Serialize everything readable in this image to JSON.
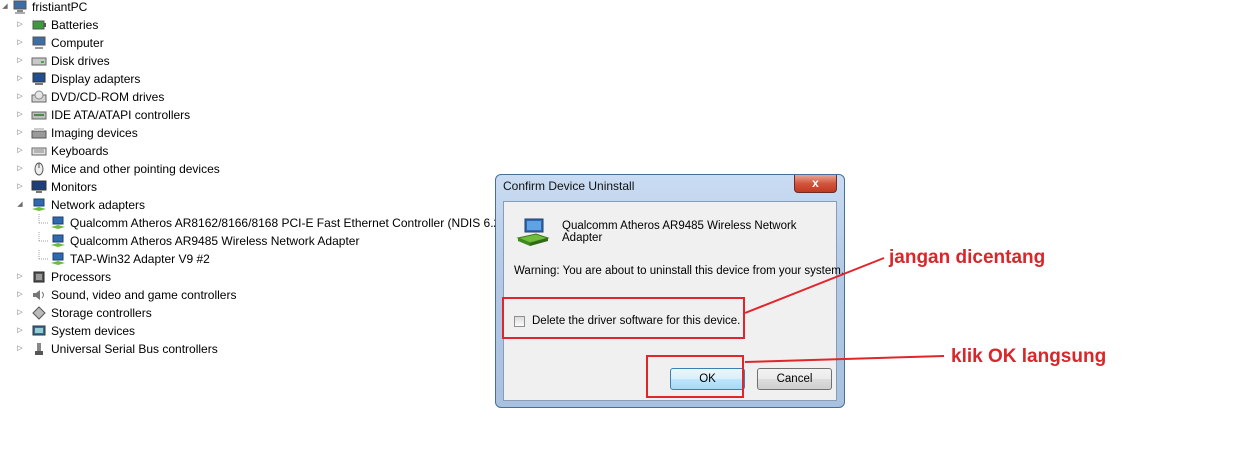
{
  "tree": {
    "root": "fristiantPC",
    "items": [
      {
        "label": "Batteries",
        "icon": "battery-icon",
        "expanded": false,
        "depth": 1
      },
      {
        "label": "Computer",
        "icon": "computer-icon",
        "expanded": false,
        "depth": 1
      },
      {
        "label": "Disk drives",
        "icon": "disk-drive-icon",
        "expanded": false,
        "depth": 1
      },
      {
        "label": "Display adapters",
        "icon": "display-adapter-icon",
        "expanded": false,
        "depth": 1
      },
      {
        "label": "DVD/CD-ROM drives",
        "icon": "dvd-drive-icon",
        "expanded": false,
        "depth": 1
      },
      {
        "label": "IDE ATA/ATAPI controllers",
        "icon": "ide-controller-icon",
        "expanded": false,
        "depth": 1
      },
      {
        "label": "Imaging devices",
        "icon": "imaging-device-icon",
        "expanded": false,
        "depth": 1
      },
      {
        "label": "Keyboards",
        "icon": "keyboard-icon",
        "expanded": false,
        "depth": 1
      },
      {
        "label": "Mice and other pointing devices",
        "icon": "mouse-icon",
        "expanded": false,
        "depth": 1
      },
      {
        "label": "Monitors",
        "icon": "monitor-icon",
        "expanded": false,
        "depth": 1
      },
      {
        "label": "Network adapters",
        "icon": "network-adapter-icon",
        "expanded": true,
        "depth": 1
      },
      {
        "label": "Qualcomm Atheros AR8162/8166/8168 PCI-E Fast Ethernet Controller (NDIS 6.20)",
        "icon": "network-adapter-icon",
        "depth": 2
      },
      {
        "label": "Qualcomm Atheros AR9485 Wireless Network Adapter",
        "icon": "network-adapter-icon",
        "depth": 2
      },
      {
        "label": "TAP-Win32 Adapter V9 #2",
        "icon": "network-adapter-icon",
        "depth": 2
      },
      {
        "label": "Processors",
        "icon": "processor-icon",
        "expanded": false,
        "depth": 1
      },
      {
        "label": "Sound, video and game controllers",
        "icon": "sound-icon",
        "expanded": false,
        "depth": 1
      },
      {
        "label": "Storage controllers",
        "icon": "storage-controller-icon",
        "expanded": false,
        "depth": 1
      },
      {
        "label": "System devices",
        "icon": "system-device-icon",
        "expanded": false,
        "depth": 1
      },
      {
        "label": "Universal Serial Bus controllers",
        "icon": "usb-icon",
        "expanded": false,
        "depth": 1
      }
    ]
  },
  "dialog": {
    "title": "Confirm Device Uninstall",
    "close_label": "x",
    "device_name": "Qualcomm Atheros AR9485 Wireless Network Adapter",
    "warning": "Warning: You are about to uninstall this device from your system.",
    "checkbox_label": "Delete the driver software for this device.",
    "checkbox_checked": false,
    "ok_label": "OK",
    "cancel_label": "Cancel"
  },
  "annotations": {
    "checkbox_note": "jangan dicentang",
    "ok_note": "klik OK langsung",
    "color": "#e0262b"
  }
}
